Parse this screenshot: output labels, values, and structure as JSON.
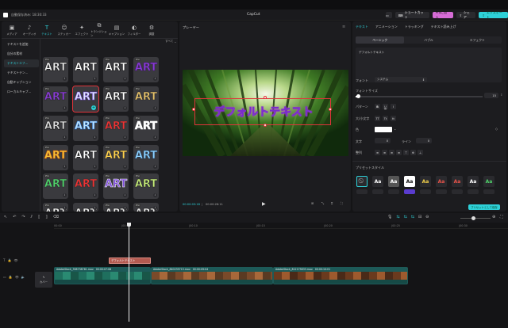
{
  "window": {
    "autosave": "自動保存済み: 18:30:33",
    "app_title": "CapCut",
    "shortcut_label": "ショートカット",
    "pro_label": "Proに加入",
    "share_label": "シェア",
    "export_label": "エクスポート"
  },
  "toolbar": {
    "items": [
      {
        "label": "メディア",
        "icon": "▣"
      },
      {
        "label": "オーディオ",
        "icon": "♪"
      },
      {
        "label": "テキスト",
        "icon": "T"
      },
      {
        "label": "ステッカー",
        "icon": "☺"
      },
      {
        "label": "エフェクト",
        "icon": "✦"
      },
      {
        "label": "トランジション",
        "icon": "⧉"
      },
      {
        "label": "キャプション",
        "icon": "▤"
      },
      {
        "label": "フィルター",
        "icon": "◐"
      },
      {
        "label": "調整",
        "icon": "⚙"
      }
    ]
  },
  "sidebar": {
    "items": [
      {
        "label": "テキストを追加"
      },
      {
        "label": "自分の素材"
      },
      {
        "label": "テキストエフ..."
      },
      {
        "label": "テキストテン..."
      },
      {
        "label": "自動キャプション"
      },
      {
        "label": "ローカルキャプ..."
      }
    ]
  },
  "library": {
    "filter_label": "すべて",
    "tile_text": "ART",
    "pro_badge": "Pro"
  },
  "player": {
    "title": "プレーヤー",
    "overlay_text": "デフォルトテキスト",
    "time_current": "00:00:03:18",
    "time_total": "00:00:26:11"
  },
  "inspector": {
    "tabs": [
      "テキスト",
      "アニメーション",
      "トラッキング",
      "テキスト読み上げ"
    ],
    "subtabs": [
      "ベーシック",
      "バブル",
      "エフェクト"
    ],
    "text_value": "デフォルトテキスト",
    "font_label": "フォント",
    "font_value": "システム",
    "size_label": "フォントサイズ",
    "size_value": "15",
    "pattern_label": "パターン",
    "case_label": "大/小文字",
    "color_label": "色",
    "char_label": "文字",
    "char_value": "0",
    "line_label": "ライン",
    "line_value": "0",
    "align_label": "整列",
    "preset_label": "プリセットスタイル",
    "save_preset": "プリセットとして保存",
    "preset_glyph": "Aa"
  },
  "timeline": {
    "ruler": [
      "00:00",
      "|00:05",
      "|00:10",
      "|00:15",
      "|00:20",
      "|00:25",
      "|00:30"
    ],
    "text_clip": "デフォルトテキスト",
    "cover_label": "カバー",
    "clips": [
      {
        "name": "AdobeStock_398738781.mov",
        "dur": "00:00:07:08"
      },
      {
        "name": "AdobeStock_840235715.mov",
        "dur": "00:00:09:04"
      },
      {
        "name": "AdobeStock_812175833.mov",
        "dur": "00:00:10:01"
      }
    ]
  },
  "colors": {
    "accent": "#2ed0d8",
    "pro_pink": "#d66cd6",
    "text_clip": "#b35a50",
    "selection": "#e0343a"
  }
}
